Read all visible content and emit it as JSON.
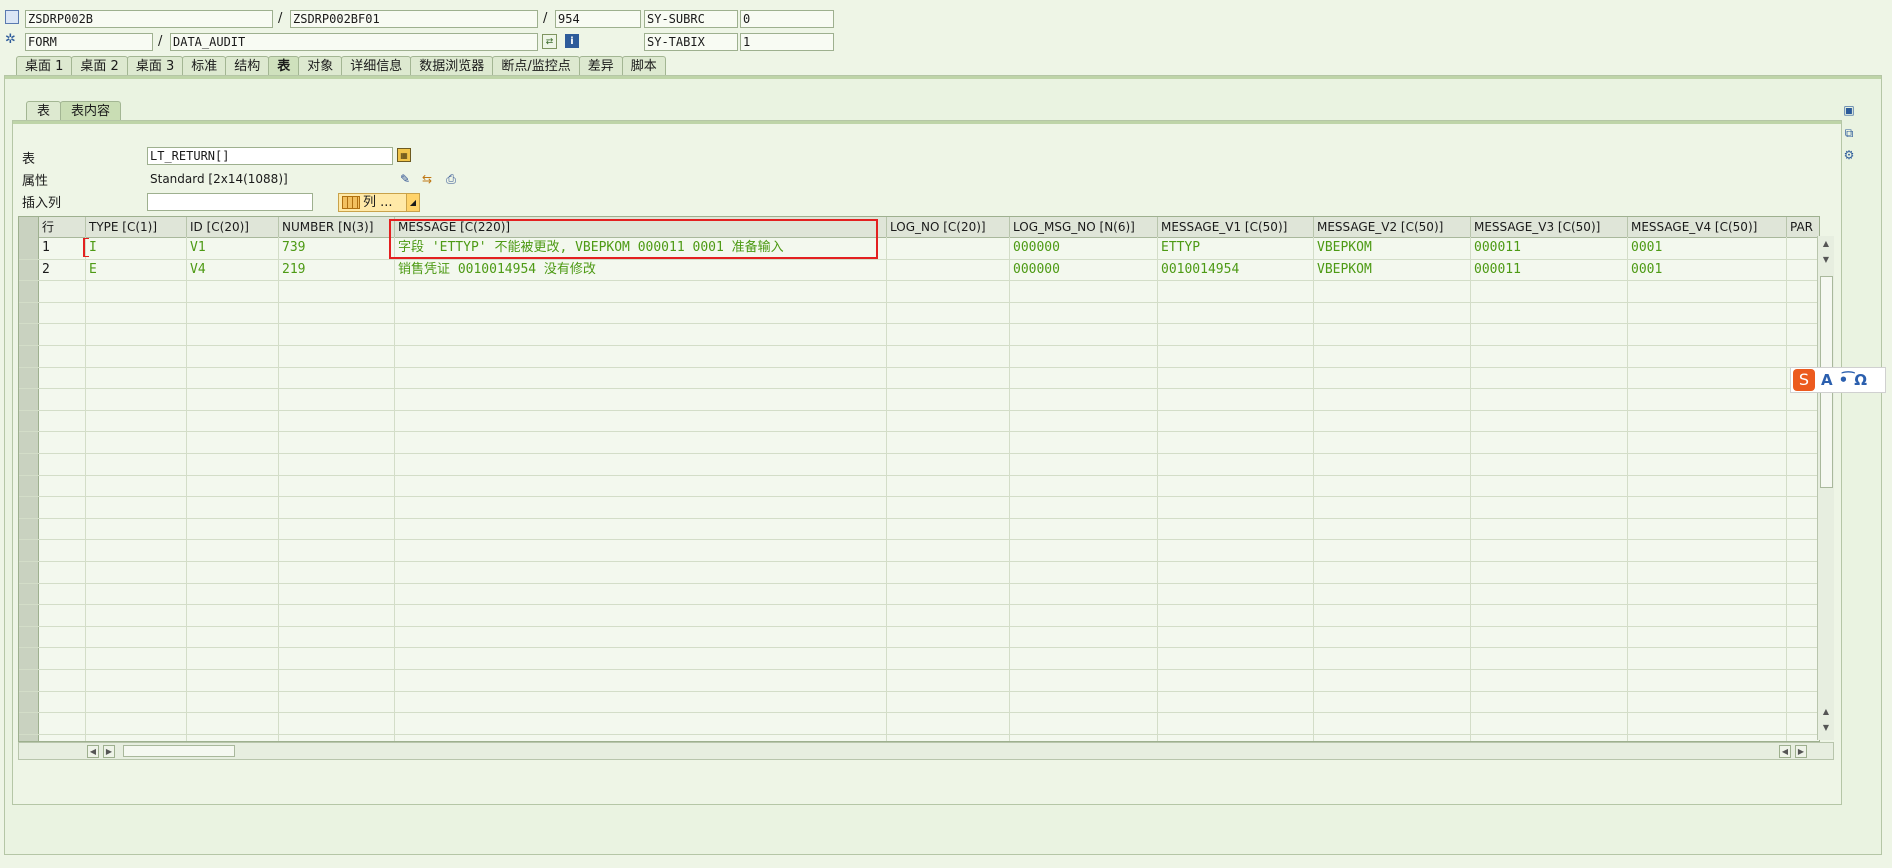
{
  "header": {
    "row1": {
      "program": "ZSDRP002B",
      "include": "ZSDRP002BF01",
      "line": "954",
      "sysfield": "SY-SUBRC",
      "sysvalue": "0"
    },
    "row2": {
      "event_type": "FORM",
      "event_name": "DATA_AUDIT",
      "sysfield": "SY-TABIX",
      "sysvalue": "1"
    },
    "sep": "/"
  },
  "tabs": [
    "桌面 1",
    "桌面 2",
    "桌面 3",
    "标准",
    "结构",
    "表",
    "对象",
    "详细信息",
    "数据浏览器",
    "断点/监控点",
    "差异",
    "脚本"
  ],
  "active_tab": "表",
  "subtabs": [
    "表",
    "表内容"
  ],
  "active_subtab": "表内容",
  "form": {
    "table_label": "表",
    "table_value": "LT_RETURN[]",
    "attr_label": "属性",
    "attr_value": "Standard [2x14(1088)]",
    "insert_label": "插入列",
    "insert_value": "",
    "columns_button": "列 ..."
  },
  "grid": {
    "columns": [
      "行",
      "TYPE [C(1)]",
      "ID [C(20)]",
      "NUMBER [N(3)]",
      "MESSAGE [C(220)]",
      "LOG_NO [C(20)]",
      "LOG_MSG_NO [N(6)]",
      "MESSAGE_V1 [C(50)]",
      "MESSAGE_V2 [C(50)]",
      "MESSAGE_V3 [C(50)]",
      "MESSAGE_V4 [C(50)]",
      "PAR"
    ],
    "rows": [
      [
        "1",
        "I",
        "V1",
        "739",
        "字段 'ETTYP' 不能被更改, VBEPKOM 000011 0001 准备输入",
        "",
        "000000",
        "ETTYP",
        "VBEPKOM",
        "000011",
        "0001",
        ""
      ],
      [
        "2",
        "E",
        "V4",
        "219",
        "销售凭证 0010014954 没有修改",
        "",
        "000000",
        "0010014954",
        "VBEPKOM",
        "000011",
        "0001",
        ""
      ]
    ]
  },
  "ime": {
    "a": "A",
    "b": "•͡",
    "c": "Ω"
  },
  "colors": {
    "value_text": "#4d9a14",
    "highlight_box": "#e32020"
  }
}
